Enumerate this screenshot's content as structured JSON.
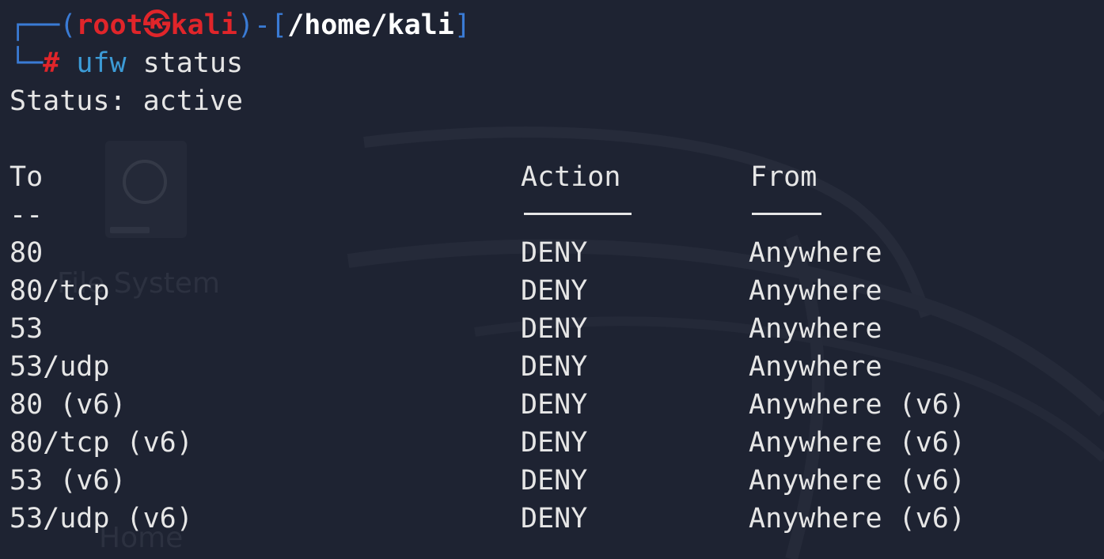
{
  "prompt": {
    "open": "┌──(",
    "user": "root",
    "at": "㉿",
    "host": "kali",
    "mid": ")-[",
    "path": "/home/kali",
    "close": "]",
    "line2_prefix": "└─",
    "hash": "#",
    "command_name": "ufw",
    "command_args": "status"
  },
  "output": {
    "status_line": "Status: active",
    "headers": {
      "to": "To",
      "action": "Action",
      "from": "From"
    },
    "dashes": {
      "to": "--"
    },
    "rows": [
      {
        "to": "80",
        "action": "DENY",
        "from": "Anywhere"
      },
      {
        "to": "80/tcp",
        "action": "DENY",
        "from": "Anywhere"
      },
      {
        "to": "53",
        "action": "DENY",
        "from": "Anywhere"
      },
      {
        "to": "53/udp",
        "action": "DENY",
        "from": "Anywhere"
      },
      {
        "to": "80 (v6)",
        "action": "DENY",
        "from": "Anywhere (v6)"
      },
      {
        "to": "80/tcp (v6)",
        "action": "DENY",
        "from": "Anywhere (v6)"
      },
      {
        "to": "53 (v6)",
        "action": "DENY",
        "from": "Anywhere (v6)"
      },
      {
        "to": "53/udp (v6)",
        "action": "DENY",
        "from": "Anywhere (v6)"
      }
    ]
  },
  "desktop": {
    "icon_label_1": "File System",
    "icon_label_2": "Home",
    "icon": "hard-drive-icon"
  },
  "colors": {
    "background": "#1e2332",
    "prompt_frame": "#3a7bd5",
    "prompt_red": "#e0252a",
    "command": "#3c9bd6",
    "text": "#e6e6e6"
  }
}
